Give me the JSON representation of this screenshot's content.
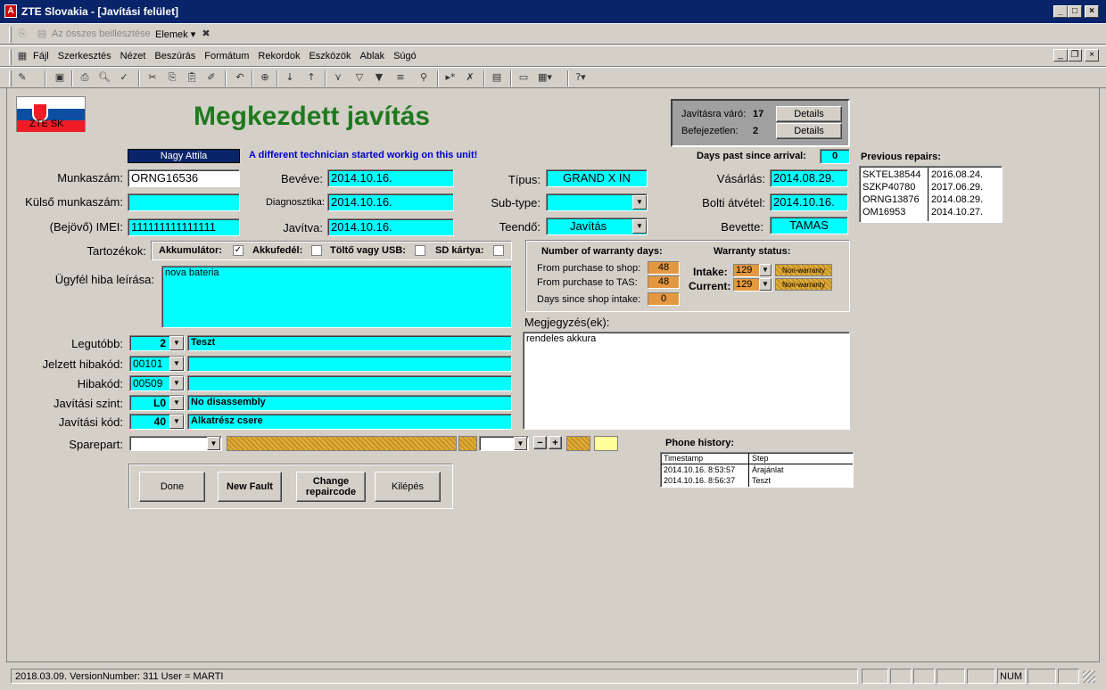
{
  "window": {
    "title": "ZTE Slovakia - [Javítási felület]",
    "app_icon": "access-icon"
  },
  "toolbar1": {
    "paste_all": "Az összes beillesztése",
    "items": "Elemek"
  },
  "menu": [
    "Fájl",
    "Szerkesztés",
    "Nézet",
    "Beszúrás",
    "Formátum",
    "Rekordok",
    "Eszközök",
    "Ablak",
    "Súgó"
  ],
  "form": {
    "flag_text": "ZTE SK",
    "title": "Megkezdett javítás",
    "counter": {
      "waiting_label": "Javításra váró:",
      "waiting_value": "17",
      "unfinished_label": "Befejezetlen:",
      "unfinished_value": "2",
      "details": "Details"
    },
    "technician": "Nagy Attila",
    "warning": "A different technician started workig on this unit!",
    "days_past_label": "Days past since arrival:",
    "days_past_value": "0",
    "fields": {
      "munkaszam_label": "Munkaszám:",
      "munkaszam": "ORNG16536",
      "kulso_label": "Külső munkaszám:",
      "kulso": "",
      "imei_label": "(Bejövő) IMEI:",
      "imei": "111111111111111",
      "beveve_label": "Bevéve:",
      "beveve": "2014.10.16.",
      "diag_label": "Diagnosztika:",
      "diag": "2014.10.16.",
      "javitva_label": "Javítva:",
      "javitva": "2014.10.16.",
      "tipus_label": "Típus:",
      "tipus": "GRAND X IN",
      "subtype_label": "Sub-type:",
      "subtype": "",
      "teendo_label": "Teendő:",
      "teendo": "Javítás",
      "vasarlas_label": "Vásárlás:",
      "vasarlas": "2014.08.29.",
      "bolti_label": "Bolti átvétel:",
      "bolti": "2014.10.16.",
      "bevette_label": "Bevette:",
      "bevette": "TAMAS"
    },
    "accessories": {
      "label": "Tartozékok:",
      "battery": "Akkumulátor:",
      "cover": "Akkufedél:",
      "charger": "Töltő vagy USB:",
      "sd": "SD kártya:",
      "checked_mark": "✓"
    },
    "fault_label": "Ügyfél hiba leírása:",
    "fault_text": "nova bateria",
    "warranty": {
      "days_title": "Number of warranty days:",
      "status_title": "Warranty status:",
      "shop_label": "From purchase to shop:",
      "shop_value": "48",
      "tas_label": "From purchase to TAS:",
      "tas_value": "48",
      "intake_days_label": "Days since shop intake:",
      "intake_days_value": "0",
      "intake_label": "Intake:",
      "intake_code": "129",
      "intake_status": "Non-warranty",
      "current_label": "Current:",
      "current_code": "129",
      "current_status": "Non-warranty"
    },
    "notes_label": "Megjegyzés(ek):",
    "notes_text": "rendeles akkura",
    "codes": [
      {
        "label": "Legutóbb:",
        "code": "2",
        "desc": "Teszt"
      },
      {
        "label": "Jelzett hibakód:",
        "code": "00101",
        "desc": ""
      },
      {
        "label": "Hibakód:",
        "code": "00509",
        "desc": ""
      },
      {
        "label": "Javítási szint:",
        "code": "L0",
        "desc": "No disassembly"
      },
      {
        "label": "Javítási kód:",
        "code": "40",
        "desc": "Alkatrész csere"
      }
    ],
    "sparepart_label": "Sparepart:",
    "buttons": {
      "done": "Done",
      "new_fault": "New Fault",
      "change": "Change repaircode",
      "exit": "Kilépés"
    },
    "previous_label": "Previous repairs:",
    "previous": [
      [
        "SKTEL38544",
        "2016.08.24."
      ],
      [
        "SZKP40780",
        "2017.06.29."
      ],
      [
        "ORNG13876",
        "2014.08.29."
      ],
      [
        "OM16953",
        "2014.10.27."
      ]
    ],
    "phone_label": "Phone history:",
    "phone_headers": [
      "Timestamp",
      "Step"
    ],
    "phone": [
      [
        "2014.10.16. 8:53:57",
        "Árajánlat"
      ],
      [
        "2014.10.16. 8:56:37",
        "Teszt"
      ]
    ]
  },
  "status": {
    "text": "2018.03.09. VersionNumber: 311 User = MARTI",
    "num": "NUM"
  },
  "colors": {
    "title_green": "#1f7a1f",
    "cyan": "#00ffff",
    "navy": "#0a246a"
  }
}
